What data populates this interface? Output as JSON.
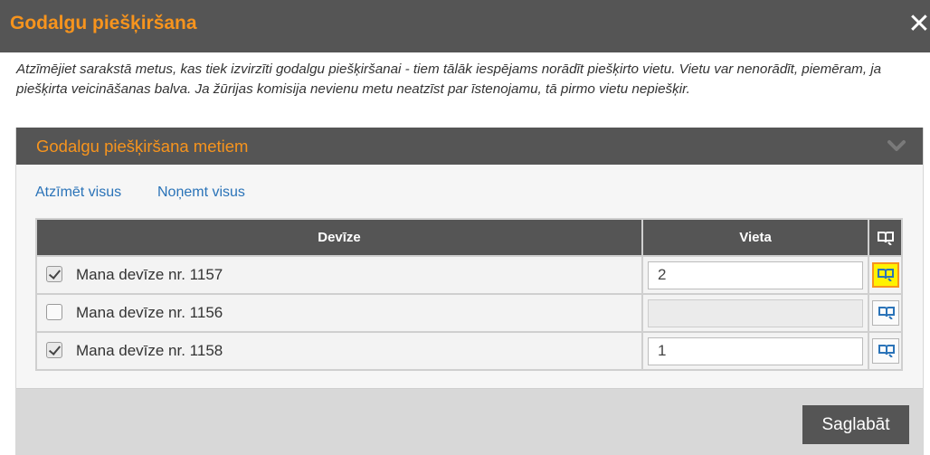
{
  "dialog": {
    "title": "Godalgu piešķiršana",
    "close_icon": "close-icon",
    "intro_text": "Atzīmējiet sarakstā metus, kas tiek izvirzīti godalgu piešķiršanai - tiem tālāk iespējams norādīt piešķirto vietu. Vietu var nenorādīt, piemēram, ja piešķirta veicināšanas balva. Ja žūrijas komisija nevienu metu neatzīst par īstenojamu, tā pirmo vietu nepiešķir."
  },
  "panel": {
    "title": "Godalgu piešķiršana metiem",
    "collapse_icon": "chevron-down-icon",
    "select_all_label": "Atzīmēt visus",
    "deselect_all_label": "Noņemt visus"
  },
  "table": {
    "headers": {
      "devize": "Devīze",
      "vieta": "Vieta",
      "icon": "book-icon"
    },
    "rows": [
      {
        "checked": true,
        "devize": "Mana devīze nr. 1157",
        "vieta": "2",
        "vieta_enabled": true,
        "highlighted": true
      },
      {
        "checked": false,
        "devize": "Mana devīze nr. 1156",
        "vieta": "",
        "vieta_enabled": false,
        "highlighted": false
      },
      {
        "checked": true,
        "devize": "Mana devīze nr. 1158",
        "vieta": "1",
        "vieta_enabled": true,
        "highlighted": false
      }
    ]
  },
  "footer": {
    "save_label": "Saglabāt"
  },
  "colors": {
    "accent": "#f7941d",
    "header_bg": "#555555",
    "link": "#2a73b8",
    "highlight": "#fff200"
  }
}
